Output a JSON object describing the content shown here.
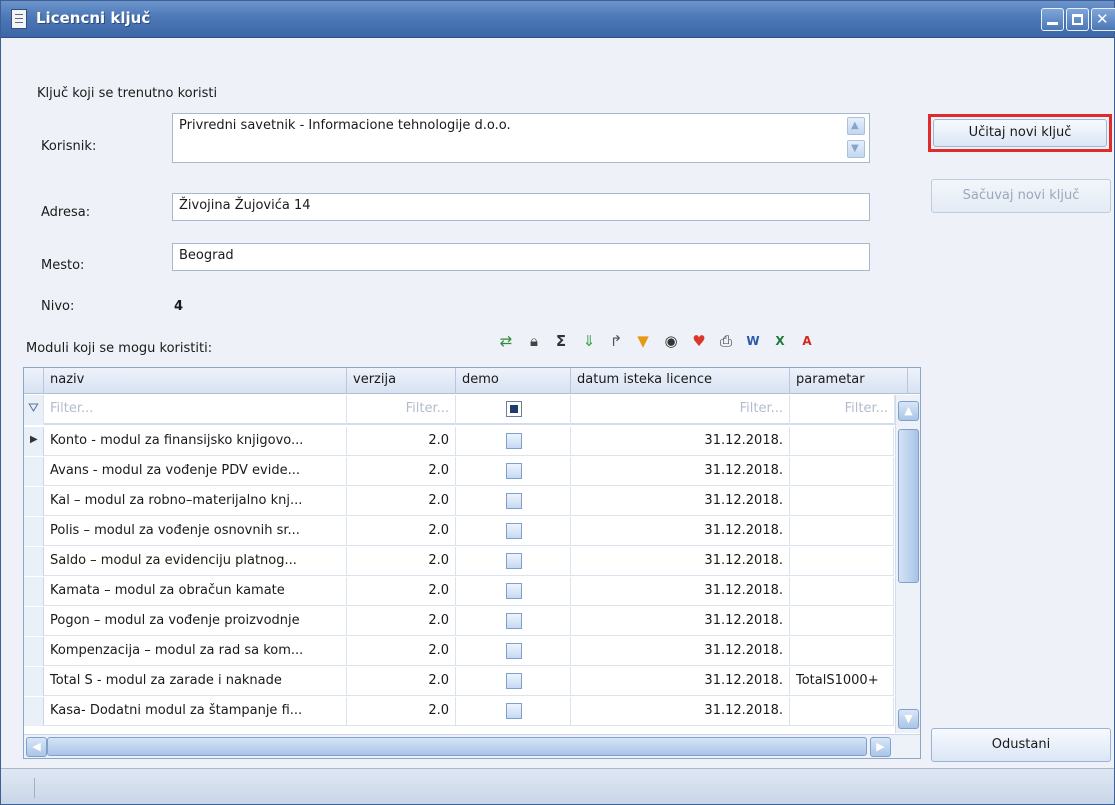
{
  "window": {
    "title": "Licencni ključ"
  },
  "current_key": {
    "section_label": "Ključ koji se trenutno koristi",
    "korisnik_label": "Korisnik:",
    "korisnik_value": "Privredni savetnik - Informacione tehnologije d.o.o.",
    "adresa_label": "Adresa:",
    "adresa_value": "Živojina Žujovića 14",
    "mesto_label": "Mesto:",
    "mesto_value": "Beograd",
    "nivo_label": "Nivo:",
    "nivo_value": "4"
  },
  "buttons": {
    "load_key": "Učitaj novi ključ",
    "save_key": "Sačuvaj novi ključ",
    "cancel": "Odustani"
  },
  "modules": {
    "label": "Moduli koji se mogu koristiti:",
    "columns": [
      "naziv",
      "verzija",
      "demo",
      "datum isteka licence",
      "parametar"
    ],
    "filter_placeholder": "Filter...",
    "rows": [
      {
        "naziv": "Konto - modul za finansijsko knjigovo...",
        "verzija": "2.0",
        "datum": "31.12.2018.",
        "parametar": ""
      },
      {
        "naziv": "Avans - modul za vođenje PDV evide...",
        "verzija": "2.0",
        "datum": "31.12.2018.",
        "parametar": ""
      },
      {
        "naziv": "Kal – modul za robno–materijalno knj...",
        "verzija": "2.0",
        "datum": "31.12.2018.",
        "parametar": ""
      },
      {
        "naziv": "Polis – modul za vođenje osnovnih sr...",
        "verzija": "2.0",
        "datum": "31.12.2018.",
        "parametar": ""
      },
      {
        "naziv": "Saldo – modul za evidenciju platnog...",
        "verzija": "2.0",
        "datum": "31.12.2018.",
        "parametar": ""
      },
      {
        "naziv": "Kamata – modul za obračun kamate",
        "verzija": "2.0",
        "datum": "31.12.2018.",
        "parametar": ""
      },
      {
        "naziv": "Pogon – modul za vođenje proizvodnje",
        "verzija": "2.0",
        "datum": "31.12.2018.",
        "parametar": ""
      },
      {
        "naziv": "Kompenzacija – modul za rad sa kom...",
        "verzija": "2.0",
        "datum": "31.12.2018.",
        "parametar": ""
      },
      {
        "naziv": "Total S - modul za zarade i naknade",
        "verzija": "2.0",
        "datum": "31.12.2018.",
        "parametar": "TotalS1000+"
      },
      {
        "naziv": "Kasa- Dodatni modul za štampanje fi...",
        "verzija": "2.0",
        "datum": "31.12.2018.",
        "parametar": ""
      }
    ]
  },
  "toolbar_icons": [
    "refresh-icon",
    "lock-icon",
    "sum-icon",
    "filter-down-icon",
    "redo-icon",
    "funnel-icon",
    "eye-icon",
    "favorite-icon",
    "print-icon",
    "word-icon",
    "excel-icon",
    "pdf-icon"
  ]
}
